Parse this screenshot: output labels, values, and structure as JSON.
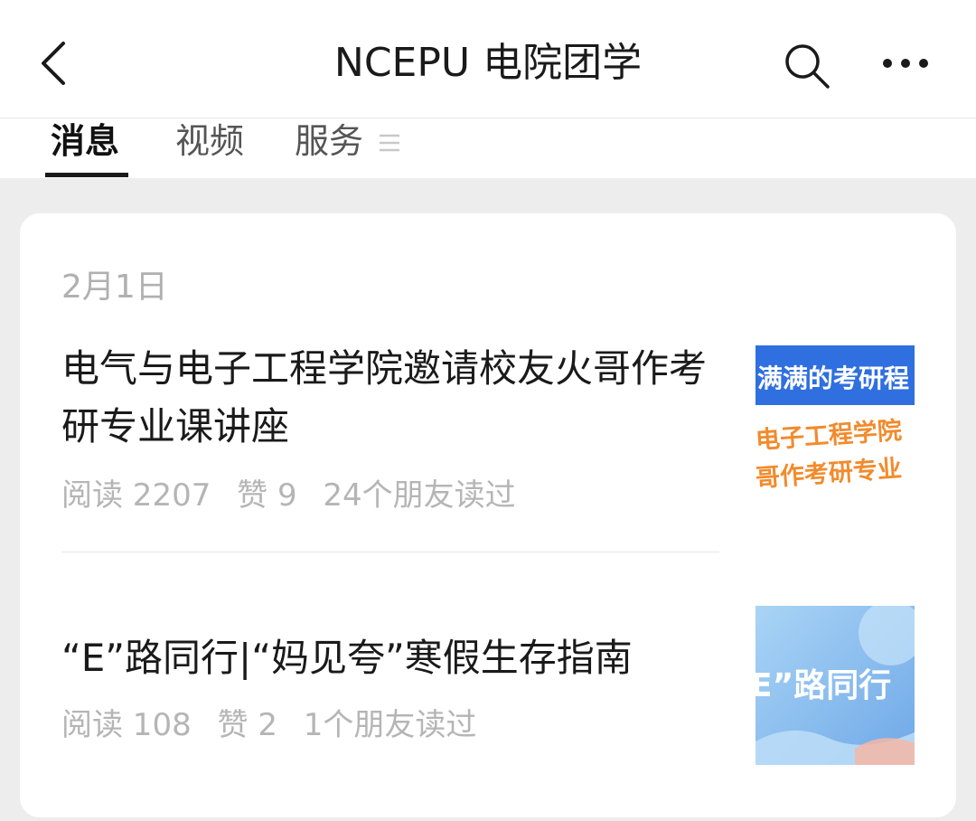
{
  "header": {
    "title": "NCEPU 电院团学"
  },
  "tabs": [
    {
      "label": "消息",
      "active": true
    },
    {
      "label": "视频",
      "active": false
    },
    {
      "label": "服务",
      "active": false
    }
  ],
  "feed": {
    "date": "2月1日",
    "articles": [
      {
        "title": "电气与电子工程学院邀请校友火哥作考研专业课讲座",
        "reads": "阅读 2207",
        "likes": "赞 9",
        "friends": "24个朋友读过",
        "thumb_text_line1": "满满的考研程",
        "thumb_text_line2": "电子工程学院",
        "thumb_text_line3": "哥作考研专业"
      },
      {
        "title": "“E”路同行|“妈见夸”寒假生存指南",
        "reads": "阅读 108",
        "likes": "赞 2",
        "friends": "1个朋友读过",
        "thumb_text": "E”路同行"
      }
    ]
  },
  "colors": {
    "background": "#ededed",
    "card": "#ffffff",
    "meta_text": "#b5b5b5",
    "thumb1_blue": "#2f6fe0",
    "thumb1_orange": "#f28b2c",
    "thumb2_blue": "#8fc2ef"
  }
}
